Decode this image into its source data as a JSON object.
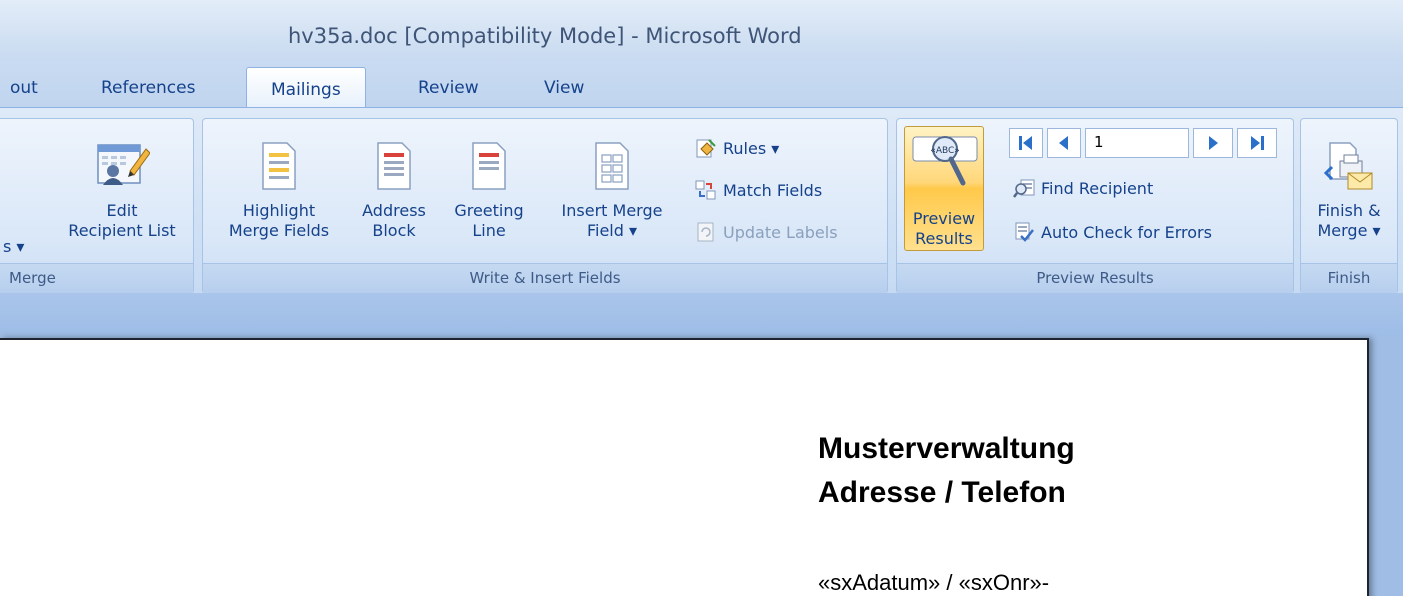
{
  "window": {
    "title": "hv35a.doc [Compatibility Mode] - Microsoft Word"
  },
  "tabs": [
    {
      "label": "out"
    },
    {
      "label": "References"
    },
    {
      "label": "Mailings",
      "active": true
    },
    {
      "label": "Review"
    },
    {
      "label": "View"
    }
  ],
  "groups": {
    "start_merge": {
      "label": "Merge",
      "partial_button": "s ▾",
      "edit_recipients": {
        "line1": "Edit",
        "line2": "Recipient List"
      }
    },
    "write_insert": {
      "label": "Write & Insert Fields",
      "highlight": {
        "line1": "Highlight",
        "line2": "Merge Fields"
      },
      "address": {
        "line1": "Address",
        "line2": "Block"
      },
      "greeting": {
        "line1": "Greeting",
        "line2": "Line"
      },
      "insert_merge": {
        "line1": "Insert Merge",
        "line2": "Field ▾"
      },
      "rules": "Rules ▾",
      "match_fields": "Match Fields",
      "update_labels": "Update Labels"
    },
    "preview": {
      "label": "Preview Results",
      "preview_results": {
        "line1": "Preview",
        "line2": "Results"
      },
      "record_number": "1",
      "find_recipient": "Find Recipient",
      "auto_check": "Auto Check for Errors"
    },
    "finish": {
      "label": "Finish",
      "finish_merge": {
        "line1": "Finish &",
        "line2": "Merge ▾"
      }
    }
  },
  "document": {
    "heading1": "Musterverwaltung",
    "heading2": "Adresse / Telefon",
    "line": "«sxAdatum» / «sxOnr»-"
  },
  "icons": {
    "edit_recipients": "address-book-edit-icon",
    "highlight": "highlight-fields-icon",
    "address": "address-block-icon",
    "greeting": "greeting-line-icon",
    "insert_merge": "insert-field-icon",
    "rules": "rules-icon",
    "match_fields": "match-fields-icon",
    "update_labels": "update-labels-icon",
    "preview": "abc-magnifier-icon",
    "first": "first-record-icon",
    "prev": "previous-record-icon",
    "next": "next-record-icon",
    "last": "last-record-icon",
    "find": "find-recipient-icon",
    "check": "check-errors-icon",
    "finish": "finish-merge-icon"
  }
}
